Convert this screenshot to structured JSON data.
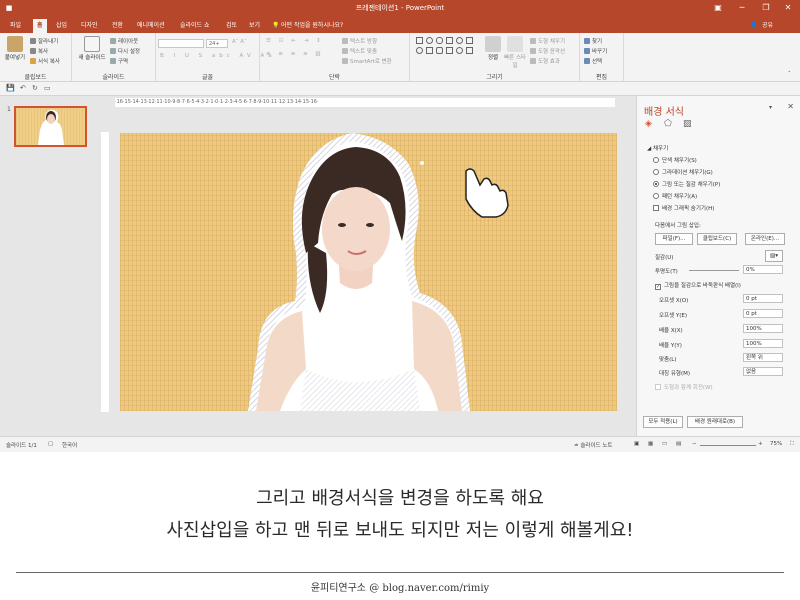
{
  "titlebar": {
    "doc_title": "프레젠테이션1 - PowerPoint",
    "minimize_icon": "minimize-icon",
    "restore_icon": "restore-icon",
    "close_icon": "close-icon"
  },
  "tabs": [
    "파일",
    "홈",
    "삽입",
    "디자인",
    "전환",
    "애니메이션",
    "슬라이드 쇼",
    "검토",
    "보기"
  ],
  "active_tab": "홈",
  "tellme": "어떤 작업을 원하시나요?",
  "share": "공유",
  "ribbon": {
    "clipboard": {
      "paste": "붙여넣기",
      "cut": "잘라내기",
      "copy": "복사",
      "format_painter": "서식 복사",
      "label": "클립보드"
    },
    "slides": {
      "new_slide": "새 슬라이드",
      "layout": "레이아웃",
      "reset": "다시 설정",
      "section": "구역",
      "label": "슬라이드"
    },
    "font": {
      "size": "24+",
      "label": "글꼴"
    },
    "paragraph": {
      "text_direction": "텍스트 방향",
      "align_text": "텍스트 맞춤",
      "smartart": "SmartArt로 변환",
      "label": "단락"
    },
    "drawing": {
      "arrange": "정렬",
      "quick_styles": "빠른 스타일",
      "shape_fill": "도형 채우기",
      "shape_outline": "도형 윤곽선",
      "shape_effects": "도형 효과",
      "label": "그리기"
    },
    "editing": {
      "find": "찾기",
      "replace": "바꾸기",
      "select": "선택",
      "label": "편집"
    }
  },
  "thumbnail": {
    "number": "1"
  },
  "ruler_text": "·16·15·14·13·12·11·10·9·8·7·6·5·4·3·2·1·0·1·2·3·4·5·6·7·8·9·10·11·12·13·14·15·16·",
  "pane": {
    "title": "배경 서식",
    "section": "채우기",
    "fill_options": [
      "단색 채우기(S)",
      "그라데이션 채우기(G)",
      "그림 또는 질감 채우기(P)",
      "패턴 채우기(A)"
    ],
    "selected_fill": 2,
    "hide_graphics": "배경 그래픽 숨기기(H)",
    "insert_from": "다음에서 그림 삽입:",
    "btn_file": "파일(F)...",
    "btn_clipboard": "클립보드(C)",
    "btn_online": "온라인(E)...",
    "texture": "질감(U)",
    "transparency": "투명도(T)",
    "transparency_value": "0%",
    "tile": "그림을 질감으로 바둑판식 배열(I)",
    "offset_x": "오프셋 X(O)",
    "offset_x_value": "0 pt",
    "offset_y": "오프셋 Y(E)",
    "offset_y_value": "0 pt",
    "scale_x": "배율 X(X)",
    "scale_x_value": "100%",
    "scale_y": "배율 Y(Y)",
    "scale_y_value": "100%",
    "alignment": "맞춤(L)",
    "alignment_value": "왼쪽 위",
    "mirror": "대칭 유형(M)",
    "mirror_value": "없음",
    "rotate": "도형과 함께 회전(W)",
    "apply_all": "모두 적용(L)",
    "reset_bg": "배경 원래대로(B)"
  },
  "status": {
    "slide": "슬라이드 1/1",
    "lang": "한국어",
    "notes": "슬라이드 노트",
    "zoom": "75%"
  },
  "caption": {
    "line1": "그리고 배경서식을 변경을 하도록 해요",
    "line2": "사진삽입을 하고 맨 뒤로 보내도 되지만 저는 이렇게 해볼게요!",
    "credit": "윤피티연구소 @ blog.naver.com/rimiy"
  },
  "colors": {
    "accent": "#b7472a",
    "slide_bg": "#efc980"
  }
}
